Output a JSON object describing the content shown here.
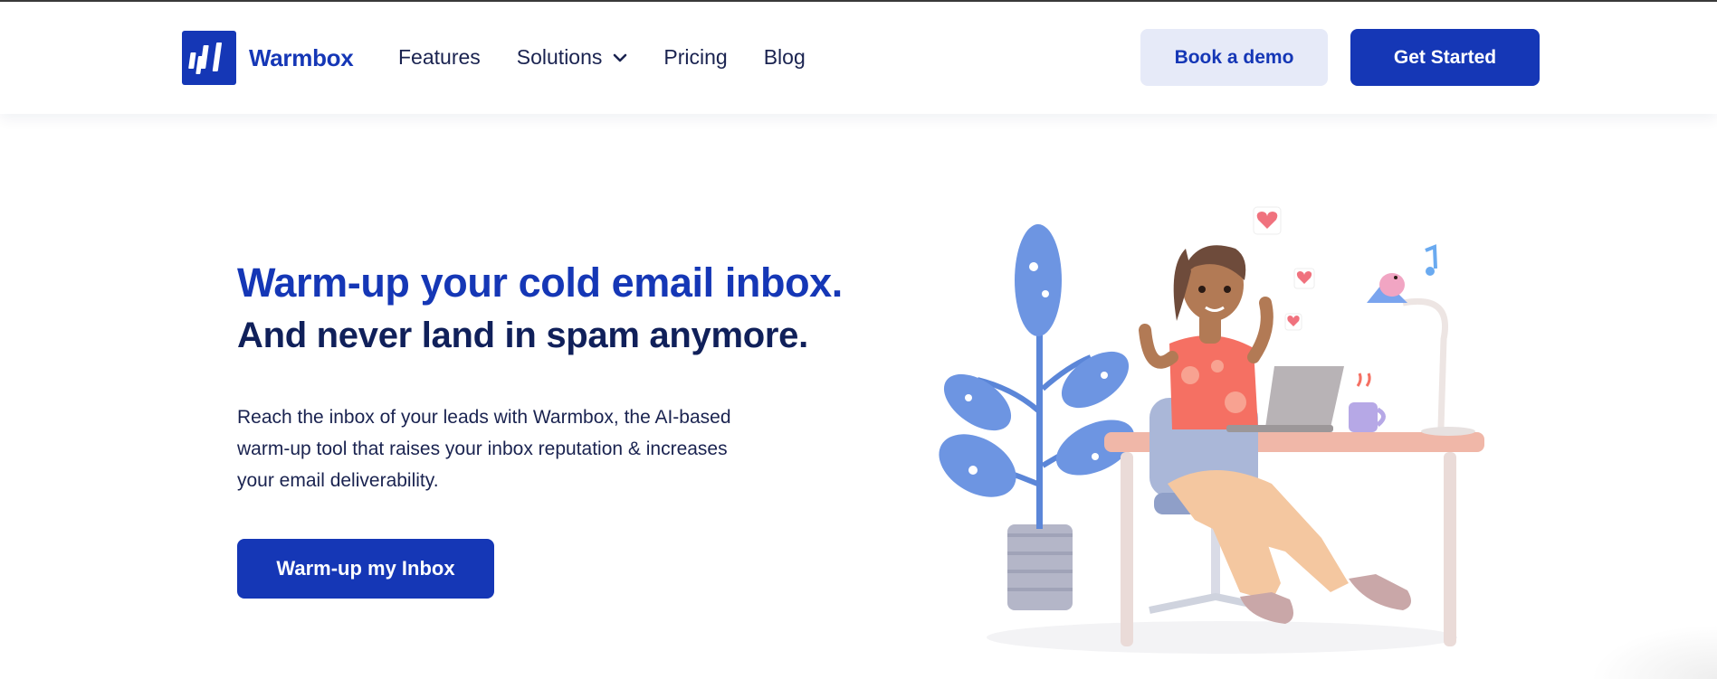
{
  "brand": {
    "name": "Warmbox",
    "color": "#1537b6"
  },
  "nav": {
    "items": [
      {
        "label": "Features"
      },
      {
        "label": "Solutions",
        "has_dropdown": true
      },
      {
        "label": "Pricing"
      },
      {
        "label": "Blog"
      }
    ]
  },
  "header": {
    "book_demo_label": "Book a demo",
    "get_started_label": "Get Started"
  },
  "hero": {
    "title_line1": "Warm-up your cold email inbox.",
    "title_line2": "And never land in spam anymore.",
    "description": "Reach the inbox of your leads with Warmbox, the AI-based warm-up tool that raises your inbox reputation & increases your email deliverability.",
    "cta_label": "Warm-up my Inbox"
  },
  "colors": {
    "primary": "#1537b6",
    "primary_light": "#e6eaf8",
    "heading_dark": "#10205a",
    "text": "#1a2350"
  },
  "icons": [
    "warmbox-logo-icon",
    "chevron-down-icon"
  ]
}
